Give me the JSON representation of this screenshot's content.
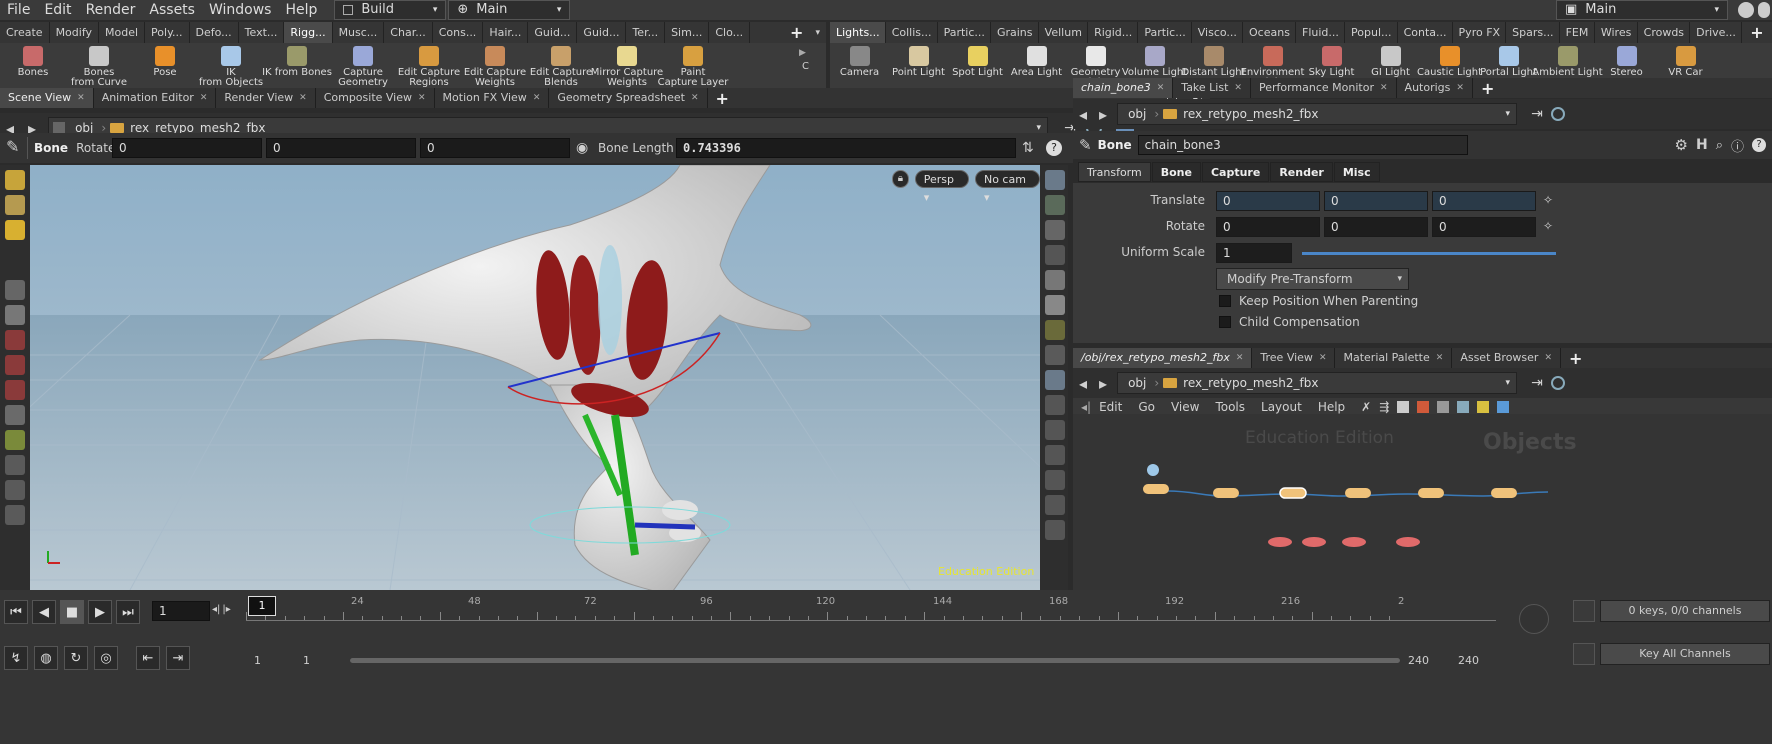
{
  "menubar": {
    "items": [
      "File",
      "Edit",
      "Render",
      "Assets",
      "Windows",
      "Help"
    ],
    "desktop": "Build",
    "context": "Main",
    "right_context": "Main"
  },
  "shelf_left": {
    "tabs": [
      "Create",
      "Modify",
      "Model",
      "Poly...",
      "Defo...",
      "Text...",
      "Rigg...",
      "Musc...",
      "Char...",
      "Cons...",
      "Hair...",
      "Guid...",
      "Guid...",
      "Ter...",
      "Sim...",
      "Clo..."
    ],
    "active_tab": "Rigg...",
    "tools": [
      {
        "label": "Bones",
        "icon": "bones-icon"
      },
      {
        "label": "Bones\nfrom Curve",
        "icon": "bones-curve-icon"
      },
      {
        "label": "Pose",
        "icon": "pose-icon"
      },
      {
        "label": "IK\nfrom Objects",
        "icon": "ik-objects-icon"
      },
      {
        "label": "IK from Bones",
        "icon": "ik-bones-icon"
      },
      {
        "label": "Capture\nGeometry",
        "icon": "capture-geometry-icon"
      },
      {
        "label": "Edit Capture\nRegions",
        "icon": "edit-capture-regions-icon"
      },
      {
        "label": "Edit Capture\nWeights",
        "icon": "edit-capture-weights-icon"
      },
      {
        "label": "Edit Capture\nBlends",
        "icon": "edit-capture-blends-icon"
      },
      {
        "label": "Mirror Capture\nWeights",
        "icon": "mirror-capture-icon"
      },
      {
        "label": "Paint\nCapture Layer",
        "icon": "paint-capture-icon"
      }
    ],
    "overflow_label": "C"
  },
  "shelf_right": {
    "tabs": [
      "Lights...",
      "Collis...",
      "Partic...",
      "Grains",
      "Vellum",
      "Rigid...",
      "Partic...",
      "Visco...",
      "Oceans",
      "Fluid...",
      "Popul...",
      "Conta...",
      "Pyro FX",
      "Spars...",
      "FEM",
      "Wires",
      "Crowds",
      "Drive..."
    ],
    "active_tab": "Lights...",
    "tools": [
      {
        "label": "Camera",
        "icon": "camera-icon"
      },
      {
        "label": "Point Light",
        "icon": "point-light-icon"
      },
      {
        "label": "Spot Light",
        "icon": "spot-light-icon"
      },
      {
        "label": "Area Light",
        "icon": "area-light-icon"
      },
      {
        "label": "Geometry\nLight",
        "icon": "geometry-light-icon"
      },
      {
        "label": "Volume Light",
        "icon": "volume-light-icon"
      },
      {
        "label": "Distant Light",
        "icon": "distant-light-icon"
      },
      {
        "label": "Environment\nLight",
        "icon": "environment-light-icon"
      },
      {
        "label": "Sky Light",
        "icon": "sky-light-icon"
      },
      {
        "label": "GI Light",
        "icon": "gi-light-icon"
      },
      {
        "label": "Caustic Light",
        "icon": "caustic-light-icon"
      },
      {
        "label": "Portal Light",
        "icon": "portal-light-icon"
      },
      {
        "label": "Ambient Light",
        "icon": "ambient-light-icon"
      },
      {
        "label": "Stereo\nCamera",
        "icon": "stereo-camera-icon"
      },
      {
        "label": "VR Car",
        "icon": "vr-camera-icon"
      }
    ]
  },
  "left_pane": {
    "tabs": [
      "Scene View",
      "Animation Editor",
      "Render View",
      "Composite View",
      "Motion FX View",
      "Geometry Spreadsheet"
    ],
    "active_tab": "Scene View",
    "path_root": "obj",
    "path_node": "rex_retypo_mesh2_fbx",
    "op_name": "Bone",
    "rotate_label": "Rotate",
    "rotate_values": [
      "0",
      "0",
      "0"
    ],
    "bone_length_label": "Bone Length",
    "bone_length_value": "0.743396",
    "view_persp": "Persp",
    "view_cam": "No cam",
    "watermark": "Education Edition"
  },
  "param_pane": {
    "tabs": [
      "chain_bone3",
      "Take List",
      "Performance Monitor",
      "Autorigs"
    ],
    "active_tab": "chain_bone3",
    "path_root": "obj",
    "path_node": "rex_retypo_mesh2_fbx",
    "node_type": "Bone",
    "node_name": "chain_bone3",
    "folder_tabs": [
      "Transform",
      "Bone",
      "Capture",
      "Render",
      "Misc"
    ],
    "active_folder": "Transform",
    "translate_label": "Translate",
    "translate": [
      "0",
      "0",
      "0"
    ],
    "rotate_label": "Rotate",
    "rotate": [
      "0",
      "0",
      "0"
    ],
    "uniform_scale_label": "Uniform Scale",
    "uniform_scale": "1",
    "uniform_scale_fraction": 1.0,
    "modify_pretransform": "Modify Pre-Transform",
    "keep_position_label": "Keep Position When Parenting",
    "child_comp_label": "Child Compensation"
  },
  "network_pane": {
    "tabs": [
      "/obj/rex_retypo_mesh2_fbx",
      "Tree View",
      "Material Palette",
      "Asset Browser"
    ],
    "active_tab": "/obj/rex_retypo_mesh2_fbx",
    "path_root": "obj",
    "path_node": "rex_retypo_mesh2_fbx",
    "menu": [
      "Edit",
      "Go",
      "View",
      "Tools",
      "Layout",
      "Help"
    ],
    "watermark": "Education Edition",
    "context_label": "Objects"
  },
  "timeline": {
    "current_frame": "1",
    "ticks": [
      "1",
      "24",
      "48",
      "72",
      "96",
      "120",
      "144",
      "168",
      "192",
      "216",
      "2"
    ],
    "range_start": "1",
    "range_start2": "1",
    "range_end": "240",
    "range_end2": "240",
    "keys_label": "0 keys, 0/0 channels",
    "key_all_label": "Key All Channels"
  }
}
